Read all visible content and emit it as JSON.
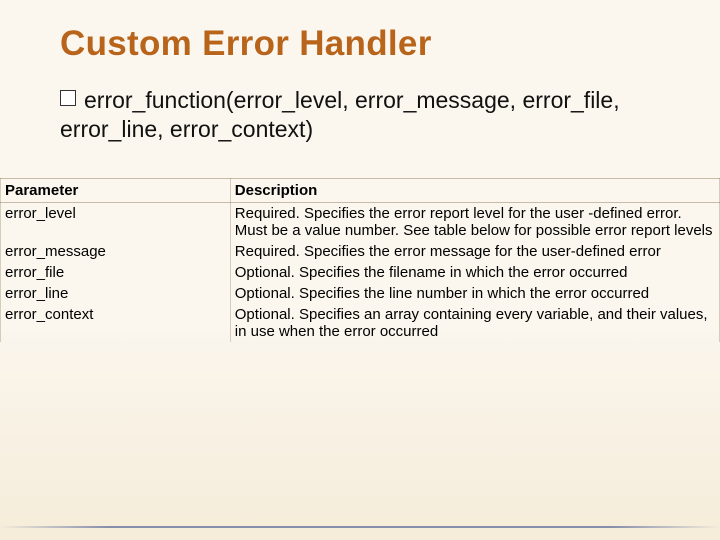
{
  "title": "Custom Error Handler",
  "bullet_text": "error_function(error_level, error_message, error_file, error_line, error_context)",
  "table": {
    "headers": {
      "param": "Parameter",
      "desc": "Description"
    },
    "rows": [
      {
        "param": "error_level",
        "desc": "Required. Specifies the error report level for the user -defined error. Must be a value number. See table below for possible error report levels"
      },
      {
        "param": "error_message",
        "desc": "Required. Specifies the error message for the user-defined error"
      },
      {
        "param": "error_file",
        "desc": "Optional. Specifies the filename in which the error occurred"
      },
      {
        "param": "error_line",
        "desc": "Optional. Specifies the line number in which the error occurred"
      },
      {
        "param": "error_context",
        "desc": "Optional. Specifies an array containing every variable, and their values, in use when the error occurred"
      }
    ]
  }
}
